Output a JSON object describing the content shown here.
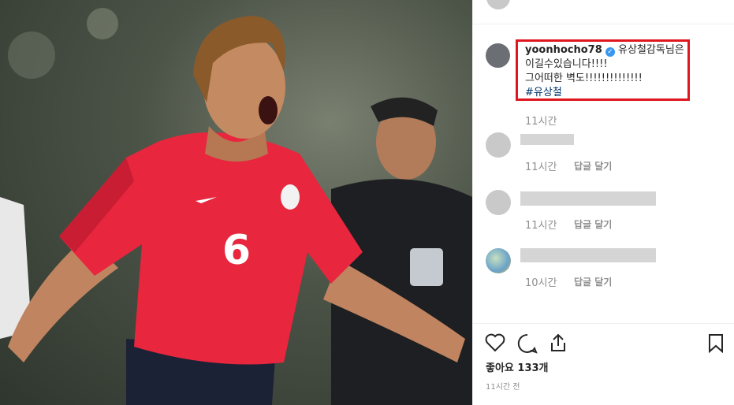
{
  "post": {
    "author": "yoonhocho78",
    "caption_line1": "유상철감독님은",
    "caption_line2": "이길수있습니다!!!!",
    "caption_line3": "그어떠한 벽도!!!!!!!!!!!!!!",
    "hashtag": "#유상철",
    "caption_time": "11시간"
  },
  "comments": [
    {
      "time": "11시간",
      "reply_label": "답글 달기"
    },
    {
      "time": "11시간",
      "reply_label": "답글 달기"
    },
    {
      "time": "10시간",
      "reply_label": "답글 달기"
    }
  ],
  "actions": {
    "likes": "좋아요 133개",
    "posted_ago": "11시간 전"
  },
  "colors": {
    "highlight": "#e0161e",
    "verified": "#3897f0",
    "hashtag": "#003569",
    "jersey": "#e8263e"
  },
  "photo": {
    "jersey_number": "6"
  }
}
